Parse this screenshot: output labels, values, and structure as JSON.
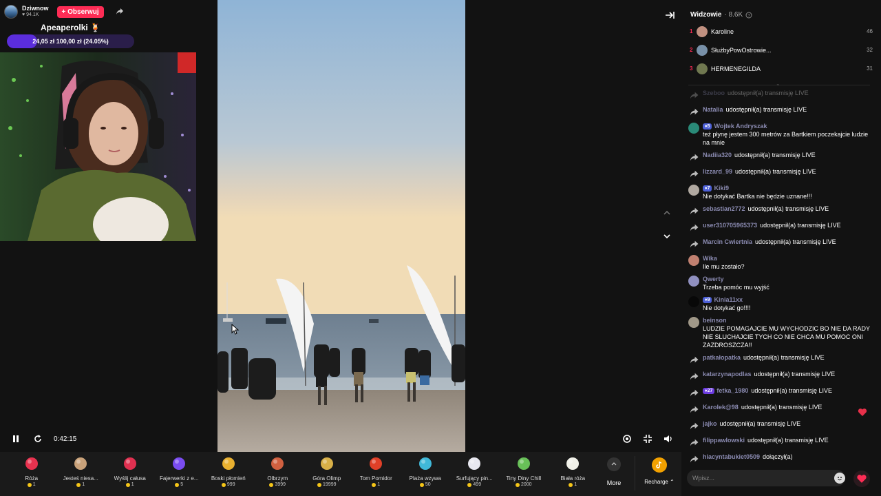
{
  "host": {
    "name": "Dziwnow",
    "likes": "94.1K",
    "follow_label": "+ Obserwuj"
  },
  "goal": {
    "title": "Apeaperolki 🍹",
    "text": "24,05 zł   100,00 zł (24.05%)",
    "progress": 0.2405
  },
  "player": {
    "time": "0:42:15"
  },
  "gifts": [
    {
      "name": "Róża",
      "price": "1",
      "icon": "rose-icon",
      "color": "#e8324f"
    },
    {
      "name": "Jesteś niesa...",
      "price": "1",
      "icon": "cat-icon",
      "color": "#c9a27a"
    },
    {
      "name": "Wyślij całusa",
      "price": "1",
      "icon": "lips-icon",
      "color": "#e03050"
    },
    {
      "name": "Fajerwerki z e...",
      "price": "5",
      "icon": "fireworks-icon",
      "color": "#7a4cf0"
    },
    {
      "name": "Boski płomień",
      "price": "999",
      "icon": "lamp-icon",
      "color": "#e8b030"
    },
    {
      "name": "Olbrzym",
      "price": "3999",
      "icon": "giant-icon",
      "color": "#d06040"
    },
    {
      "name": "Góra Olimp",
      "price": "19999",
      "icon": "mountain-icon",
      "color": "#d8b048"
    },
    {
      "name": "Tom Pomidor",
      "price": "1",
      "icon": "tomato-icon",
      "color": "#e04028"
    },
    {
      "name": "Plaża wzywa",
      "price": "50",
      "icon": "beach-icon",
      "color": "#40b8d8"
    },
    {
      "name": "Surfujący pin...",
      "price": "499",
      "icon": "penguin-icon",
      "color": "#e8e8f0"
    },
    {
      "name": "Tiny Diny Chill",
      "price": "2000",
      "icon": "dino-icon",
      "color": "#68c058"
    },
    {
      "name": "Biała róża",
      "price": "1",
      "icon": "white-rose-icon",
      "color": "#f0f0e8"
    }
  ],
  "more_label": "More",
  "recharge_label": "Recharge ⌃",
  "viewers": {
    "title": "Widzowie",
    "count": "· 8.6K",
    "top": [
      {
        "rank": "1",
        "name": "Karoline",
        "score": "46",
        "color": "#c09080"
      },
      {
        "rank": "2",
        "name": "SłużbyPowOstrowie...",
        "score": "32",
        "color": "#7890a8"
      },
      {
        "rank": "3",
        "name": "HERMENEGILDA",
        "score": "31",
        "color": "#707850"
      }
    ]
  },
  "chat": [
    {
      "type": "share",
      "user": "Szeboo",
      "text": "udostępnił(a) transmisję LIVE",
      "faded": true
    },
    {
      "type": "share",
      "user": "Natalia",
      "text": "udostępnił(a) transmisję LIVE"
    },
    {
      "type": "msg",
      "user": "Wojtek Andryszak",
      "badge": "5",
      "text": "też płynę jestem 300 metrów za Bartkiem poczekajcie ludzie na mnie",
      "color": "#2a8a78"
    },
    {
      "type": "share",
      "user": "Nadiia320",
      "text": "udostępnił(a) transmisję LIVE"
    },
    {
      "type": "share",
      "user": "lizzard_99",
      "text": "udostępnił(a) transmisję LIVE"
    },
    {
      "type": "msg",
      "user": "Kiki9",
      "badge": "7",
      "text": "Nie dotykać Bartka nie będzie uznane!!!",
      "color": "#b0a8a0"
    },
    {
      "type": "share",
      "user": "sebastian2772",
      "text": "udostępnił(a) transmisję LIVE"
    },
    {
      "type": "share",
      "user": "user310705965373",
      "text": "udostępnił(a) transmisję LIVE"
    },
    {
      "type": "share",
      "user": "Marcin Cwiertnia",
      "text": "udostępnił(a) transmisję LIVE"
    },
    {
      "type": "msg",
      "user": "Wika",
      "text": "Ile mu zostało?",
      "color": "#c08070"
    },
    {
      "type": "msg",
      "user": "Qwerty",
      "text": "Trzeba pomóc mu wyjść",
      "color": "#9090c0"
    },
    {
      "type": "msg",
      "user": "Kinia11xx",
      "badge": "9",
      "text": "Nie dotykać go!!!!",
      "color": "#080808"
    },
    {
      "type": "msg",
      "user": "beinson",
      "text": "LUDZIE POMAGAJCIE MU WYCHODZIC BO NIE DA RADY NIE SLUCHAJCIE TYCH CO NIE CHCA MU POMOC ONI ZAZDROSZCZA!!",
      "color": "#a09888"
    },
    {
      "type": "share",
      "user": "patkałopatka",
      "text": "udostępnił(a) transmisję LIVE"
    },
    {
      "type": "share",
      "user": "katarzynapodlas",
      "text": "udostępnił(a) transmisję LIVE"
    },
    {
      "type": "share",
      "user": "fetka_1980",
      "badge": "27",
      "badge_style": "purple",
      "text": "udostępnił(a) transmisję LIVE"
    },
    {
      "type": "share",
      "user": "Karolek@98",
      "text": "udostępnił(a) transmisję LIVE"
    },
    {
      "type": "share",
      "user": "jajko",
      "text": "udostępnił(a) transmisję LIVE"
    },
    {
      "type": "share",
      "user": "filippawlowski",
      "text": "udostępnił(a) transmisję LIVE"
    },
    {
      "type": "share",
      "user": "hiacyntabukiet0509",
      "text": "dołączył(a)"
    }
  ],
  "input": {
    "placeholder": "Wpisz..."
  },
  "colors": {
    "accent": "#fe2c55",
    "username": "#8a8ab0",
    "goal_fill": "#5b2ddc"
  }
}
